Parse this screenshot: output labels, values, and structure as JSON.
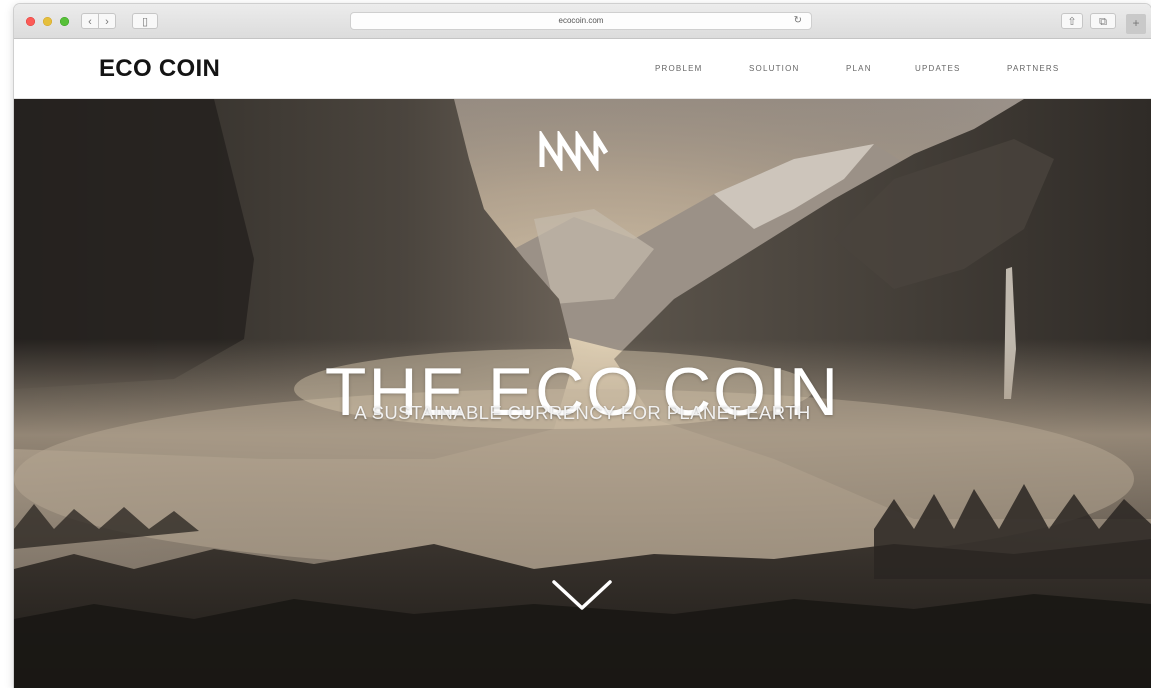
{
  "browser": {
    "url": "ecocoin.com",
    "back_glyph": "‹",
    "forward_glyph": "›",
    "sidebar_glyph": "▯",
    "share_glyph": "⇧",
    "tabs_glyph": "⧉",
    "reload_glyph": "↻",
    "new_tab_glyph": "+",
    "icons": [
      "back-icon",
      "forward-icon",
      "sidebar-icon",
      "share-icon",
      "tabs-icon",
      "reload-icon",
      "new-tab-icon"
    ]
  },
  "site": {
    "logo": "ECO COIN",
    "nav": [
      "PROBLEM",
      "SOLUTION",
      "PLAN",
      "UPDATES",
      "PARTNERS"
    ]
  },
  "hero": {
    "title": "THE ECO COIN",
    "subtitle": "A SUSTAINABLE CURRENCY FOR PLANET EARTH",
    "mark_icon": "eco-coin-monogram-icon",
    "scroll_icon": "chevron-down-icon",
    "background": "misty-valley-photo"
  },
  "colors": {
    "traffic_red": "#fc5b57",
    "traffic_yellow": "#e5bf3c",
    "traffic_green": "#57c038",
    "logo": "#141414",
    "nav_text": "#666666",
    "hero_text": "#ffffff"
  }
}
